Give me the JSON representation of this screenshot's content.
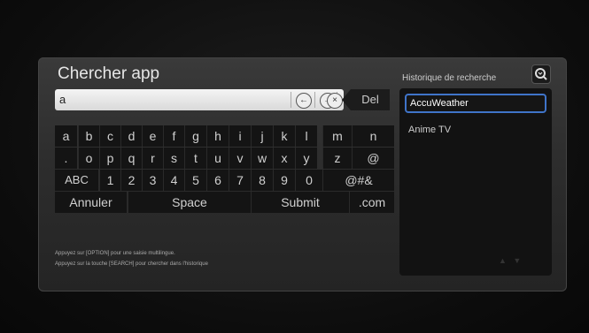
{
  "title": "Chercher app",
  "search": {
    "value": "a"
  },
  "field_buttons": [
    "←",
    "→",
    "×"
  ],
  "del_label": "Del",
  "keyboard": {
    "row1": [
      "a",
      "b",
      "c",
      "d",
      "e",
      "f",
      "g",
      "h",
      "i",
      "j",
      "k",
      "l",
      "m",
      "n"
    ],
    "row2": [
      ".",
      "o",
      "p",
      "q",
      "r",
      "s",
      "t",
      "u",
      "v",
      "w",
      "x",
      "y",
      "z",
      "@"
    ],
    "row3": [
      "ABC",
      "1",
      "2",
      "3",
      "4",
      "5",
      "6",
      "7",
      "8",
      "9",
      "0",
      "@#&"
    ],
    "row4": [
      "Annuler",
      "Space",
      "Submit",
      ".com"
    ]
  },
  "hints": [
    "Appuyez sur [OPTION] pour une saisie multilingue.",
    "Appuyez sur la touche [SEARCH] pour chercher dans l'historique"
  ],
  "history": {
    "label": "Historique de recherche",
    "items": [
      "AccuWeather",
      "Anime TV"
    ],
    "selected_index": 0
  },
  "colors": {
    "selection": "#3f74c9",
    "panel": "#2d2d2d",
    "key": "#141414"
  }
}
